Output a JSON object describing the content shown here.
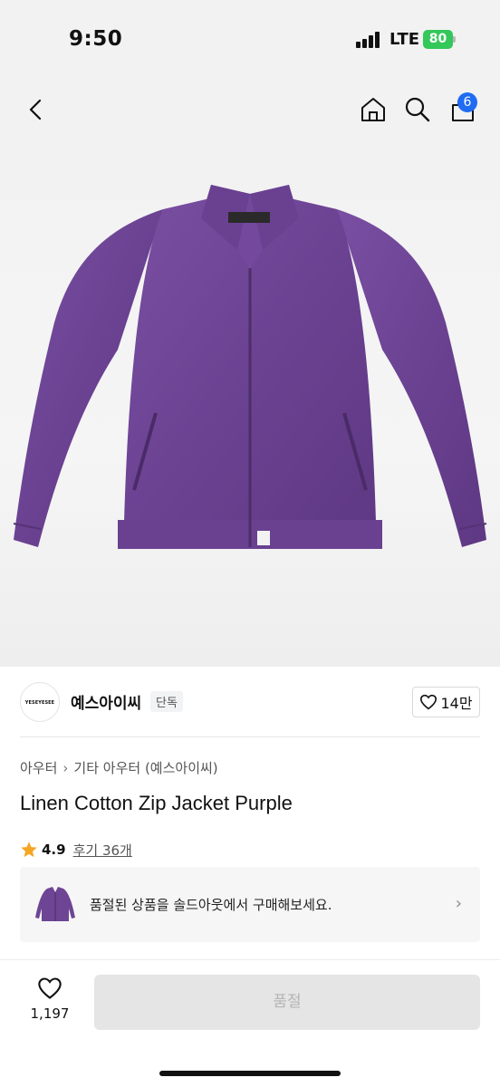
{
  "status_bar": {
    "time": "9:50",
    "network": "LTE",
    "battery": "80"
  },
  "nav": {
    "cart_count": "6"
  },
  "brand": {
    "logo_text": "YESEYESEE",
    "name": "예스아이씨",
    "tag": "단독",
    "likes": "14만"
  },
  "breadcrumb": {
    "level1": "아우터",
    "level2": "기타 아우터 (예스아이씨)"
  },
  "product": {
    "title": "Linen Cotton Zip Jacket Purple",
    "color": "#6e4594"
  },
  "rating": {
    "score": "4.9",
    "reviews": "후기 36개"
  },
  "soldout": {
    "text": "품절된 상품을 솔드아웃에서 구매해보세요."
  },
  "bottom": {
    "wish_count": "1,197",
    "buy_label": "품절"
  }
}
